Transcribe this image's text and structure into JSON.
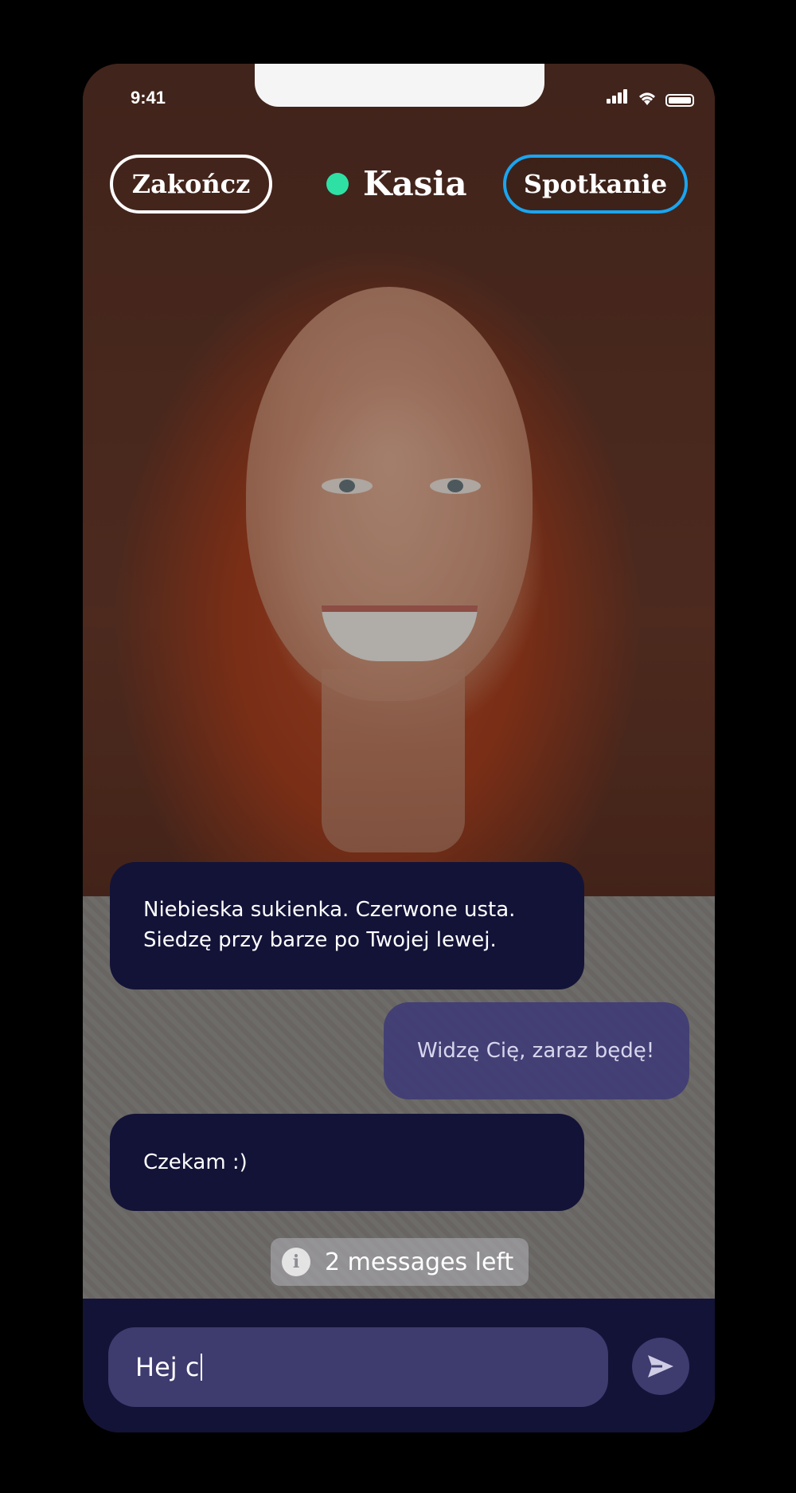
{
  "status_bar": {
    "time": "9:41",
    "icons": [
      "cellular-signal-icon",
      "wifi-icon",
      "battery-icon"
    ]
  },
  "header": {
    "end_button_label": "Zakończ",
    "contact_name": "Kasia",
    "contact_status_color": "#2fe0a5",
    "meet_button_label": "Spotkanie",
    "meet_button_accent": "#1aa5f0"
  },
  "messages": [
    {
      "direction": "incoming",
      "lines": [
        "Niebieska sukienka. Czerwone usta.",
        "Siedzę przy barze po Twojej lewej."
      ]
    },
    {
      "direction": "outgoing",
      "lines": [
        "Widzę Cię, zaraz będę!"
      ]
    },
    {
      "direction": "incoming",
      "lines": [
        "Czekam :)"
      ]
    }
  ],
  "quota": {
    "icon": "info-icon",
    "icon_glyph": "i",
    "text": "2 messages left"
  },
  "composer": {
    "input_value": "Hej c",
    "send_icon": "send-icon"
  },
  "colors": {
    "bubble_incoming": "#131338",
    "bubble_outgoing": "#3e3a76",
    "composer_bg": "#131338"
  }
}
